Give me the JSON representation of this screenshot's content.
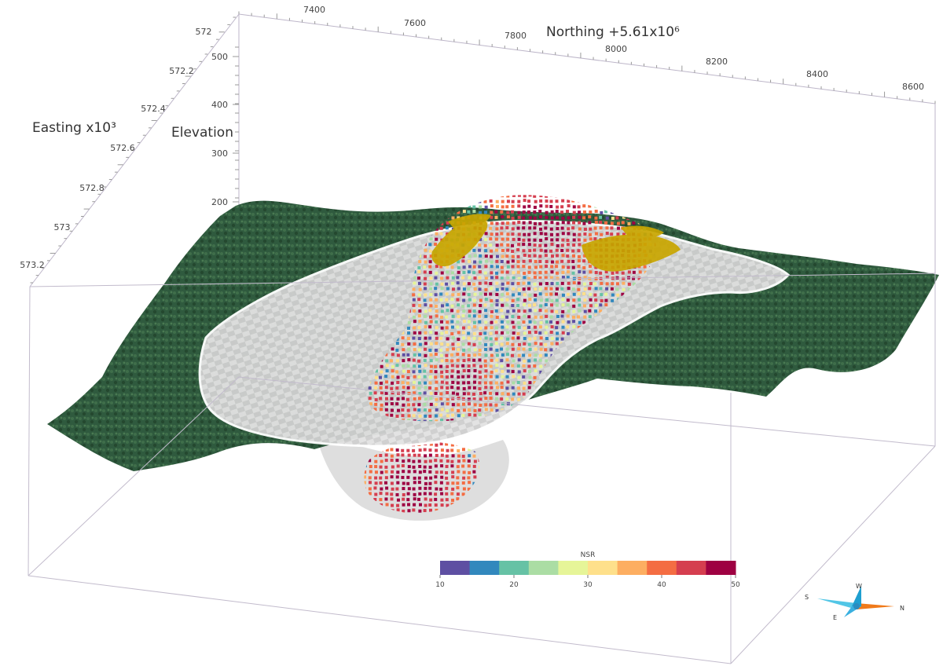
{
  "chart_data": {
    "type": "scatter",
    "title": "",
    "axes": {
      "northing": {
        "label": "Northing +5.61x10⁶",
        "ticks": [
          "7400",
          "7600",
          "7800",
          "8000",
          "8200",
          "8400",
          "8600"
        ]
      },
      "easting": {
        "label": "Easting x10³",
        "ticks": [
          "572",
          "572.2",
          "572.4",
          "572.6",
          "572.8",
          "573",
          "573.2"
        ]
      },
      "elevation": {
        "label": "Elevation",
        "ticks": [
          "500",
          "400",
          "300",
          "200"
        ]
      }
    },
    "colorbar": {
      "label": "NSR",
      "range": [
        10,
        50
      ],
      "ticks": [
        "10",
        "20",
        "30",
        "40",
        "50"
      ],
      "bins": [
        "#5e4fa2",
        "#3288bd",
        "#66c2a5",
        "#abdda4",
        "#e6f598",
        "#fee08b",
        "#fdae61",
        "#f46d43",
        "#d53e4f",
        "#9e0142"
      ]
    },
    "layers": {
      "terrain_color": "#2f5a3e",
      "pit_shell_color": "#dedede",
      "ore_zone_color": "#c9a600"
    },
    "compass": {
      "labels": [
        "S",
        "W",
        "E",
        "N"
      ]
    }
  }
}
